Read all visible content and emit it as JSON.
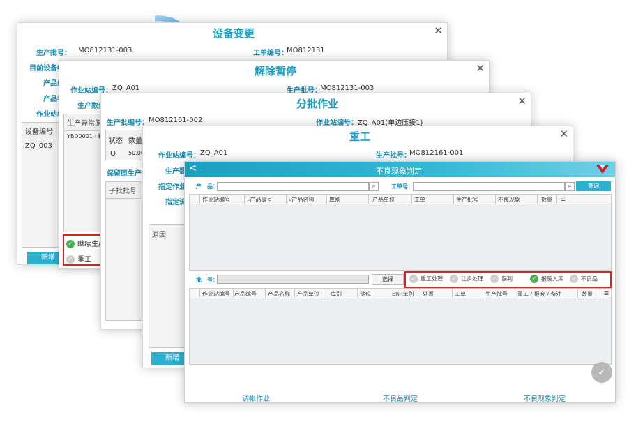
{
  "d1": {
    "title": "设备变更",
    "lbl_batch": "生产批号：",
    "val_batch": "MO812131-003",
    "lbl_wo": "工单编号：",
    "val_wo": "MO812131",
    "r1": "目前设备编",
    "r2": "产品编",
    "r3": "产品名",
    "r4": "作业站编",
    "col": "设备编号",
    "cell": "ZQ_003",
    "btn": "新增"
  },
  "d2": {
    "title": "解除暂停",
    "lbl_ws": "作业站编号：",
    "val_ws": "ZQ_A01",
    "lbl_batch": "生产批号：",
    "val_batch": "MO812131-003",
    "r1": "生产数量",
    "col": "生产异常原",
    "cell": "YBD0001 · 料",
    "opt1": "继续生产",
    "opt2": "重工"
  },
  "d3": {
    "title": "分批作业",
    "lbl_batch": "生产批编号：",
    "val_batch": "MO812161-002",
    "lbl_ws": "作业站编号：",
    "val_ws": "ZQ_A01(单边压接1)",
    "c1": "状态",
    "c2": "数量",
    "cell1": "Q",
    "cell2": "50.000",
    "r1": "保留原生产批",
    "sub": "子批批号"
  },
  "d4": {
    "title": "重工",
    "lbl_ws": "作业站编号：",
    "val_ws": "ZQ_A01",
    "lbl_batch": "生产批号：",
    "val_batch": "MO812161-001",
    "r1": "生产数",
    "r2": "指定作业",
    "r3": "指定流",
    "reason": "原因",
    "btn": "新增"
  },
  "main": {
    "title": "不良现象判定",
    "lbl_product": "产　品：",
    "lbl_wo": "工单号：",
    "query": "查询",
    "grid1_cols": [
      "作业站编号",
      "产品编号",
      "产品名称",
      "库别",
      "产品单位",
      "工单",
      "生产批号",
      "不良现象",
      "数量"
    ],
    "lbl_batch": "批　号：",
    "select": "选择",
    "opts": [
      "重工处理",
      "让步处理",
      "误判",
      "报废入库",
      "不良品"
    ],
    "grid2_cols": [
      "作业站编号",
      "产品编号",
      "产品名称",
      "产品单位",
      "库别",
      "储位",
      "ERP单别",
      "处置",
      "工单",
      "生产批号",
      "重工 / 报废 / 备注",
      "数量"
    ],
    "foot": [
      "调帐作业",
      "不良品判定",
      "不良现象判定"
    ]
  },
  "colors": {
    "accent": "#2cb0cf",
    "title": "#1aa0c4",
    "highlight": "#e02020"
  }
}
